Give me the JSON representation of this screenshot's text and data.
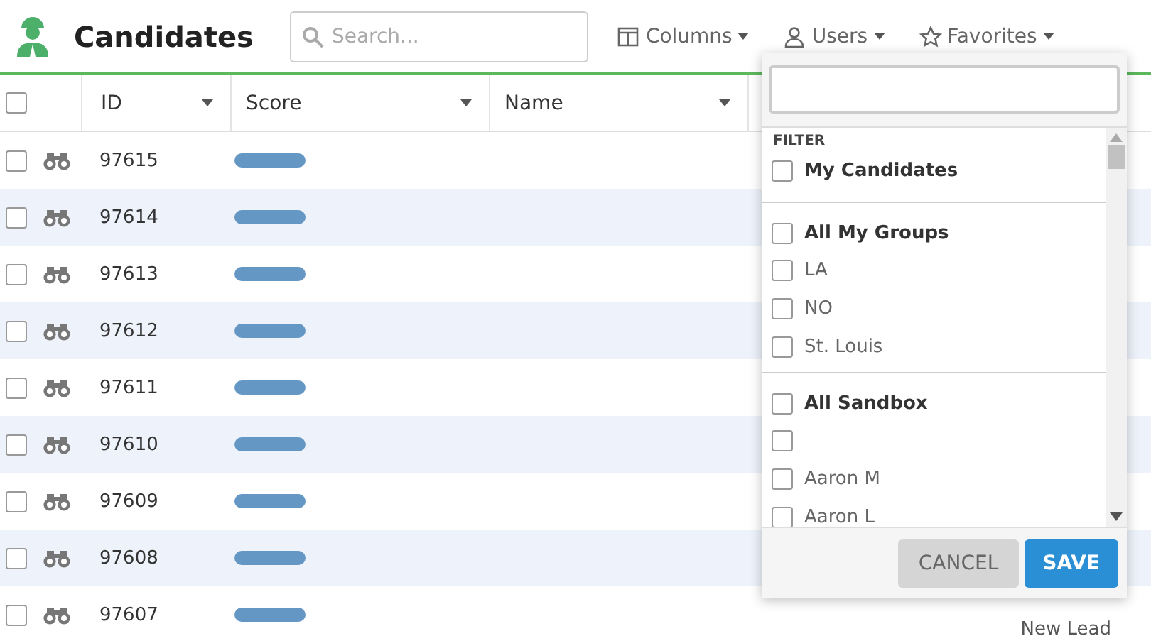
{
  "header": {
    "title": "Candidates",
    "search": {
      "placeholder": "Search..."
    },
    "menus": [
      {
        "kind": "columns",
        "label": "Columns"
      },
      {
        "kind": "users",
        "label": "Users"
      },
      {
        "kind": "favorites",
        "label": "Favorites"
      }
    ]
  },
  "table": {
    "select_all": {
      "checked": false
    },
    "columns": [
      "ID",
      "Score",
      "Name"
    ],
    "rows": [
      {
        "checked": false,
        "id": "97615"
      },
      {
        "checked": false,
        "id": "97614"
      },
      {
        "checked": false,
        "id": "97613"
      },
      {
        "checked": false,
        "id": "97612"
      },
      {
        "checked": false,
        "id": "97611"
      },
      {
        "checked": false,
        "id": "97610"
      },
      {
        "checked": false,
        "id": "97609"
      },
      {
        "checked": false,
        "id": "97608"
      },
      {
        "checked": false,
        "id": "97607",
        "status": "New Lead"
      }
    ]
  },
  "users_dropdown": {
    "heading": "FILTER",
    "sections": [
      {
        "label": "My Candidates",
        "checked": false
      },
      {
        "label": "All My Groups",
        "checked": false,
        "items": [
          {
            "label": "LA",
            "checked": false
          },
          {
            "label": "NO",
            "checked": false
          },
          {
            "label": "St. Louis",
            "checked": false
          }
        ]
      },
      {
        "label": "All Sandbox",
        "checked": false,
        "items": [
          {
            "checked": false
          },
          {
            "label": "Aaron M",
            "checked": false
          },
          {
            "label": "Aaron L",
            "checked": false
          }
        ]
      }
    ],
    "buttons": [
      {
        "kind": "cancel",
        "label": "CANCEL"
      },
      {
        "kind": "save",
        "label": "SAVE"
      }
    ]
  }
}
